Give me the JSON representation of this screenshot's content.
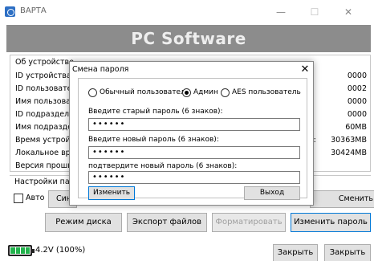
{
  "window": {
    "title": "ВАРТА",
    "min_glyph": "—",
    "max_glyph": "☐",
    "close_glyph": "✕"
  },
  "header": {
    "banner_text": "PC Software"
  },
  "info": {
    "heading": "Об устройстве",
    "rows": [
      {
        "label": "ID устройства",
        "value": "0000"
      },
      {
        "label": "ID пользователя",
        "value": "0002"
      },
      {
        "label": "Имя пользователя",
        "value": "0000"
      },
      {
        "label": "ID подразделения",
        "value": "0000"
      },
      {
        "label": "Имя подразделения",
        "value": "60MB"
      },
      {
        "label": "Время устройства",
        "value": "30363MB",
        "extra": "ь:"
      },
      {
        "label": "Локальное время",
        "value": "30424MB"
      },
      {
        "label": "Версия прошивки",
        "value": ""
      }
    ]
  },
  "settings": {
    "heading": "Настройки параметров",
    "auto_label": "Авто",
    "left_button_label": "Синхронизировать",
    "right_button_label": "Сменить пользователь"
  },
  "buttons": {
    "disk_mode": "Режим диска",
    "export_files": "Экспорт файлов",
    "format": "Форматировать",
    "change_password": "Изменить пароль",
    "close_1": "Закрыть",
    "close_2": "Закрыть"
  },
  "battery": {
    "level": 1.0,
    "text": "4.2V (100%)",
    "color": "#22b24c"
  },
  "dialog": {
    "title": "Смена пароля",
    "close_glyph": "✕",
    "radios": [
      {
        "label": "Обычный пользователь",
        "checked": false
      },
      {
        "label": "Админ",
        "checked": true
      },
      {
        "label": "AES пользователь",
        "checked": false
      }
    ],
    "old_pwd_label": "Введите старый пароль (6 знаков):",
    "old_pwd_value": "••••••",
    "new_pwd_label": "Введите новый пароль (6 знаков):",
    "new_pwd_value": "••••••",
    "confirm_pwd_label": "подтвердите новый пароль (6 знаков):",
    "confirm_pwd_value": "••••••",
    "change_button": "Изменить",
    "exit_button": "Выход"
  }
}
